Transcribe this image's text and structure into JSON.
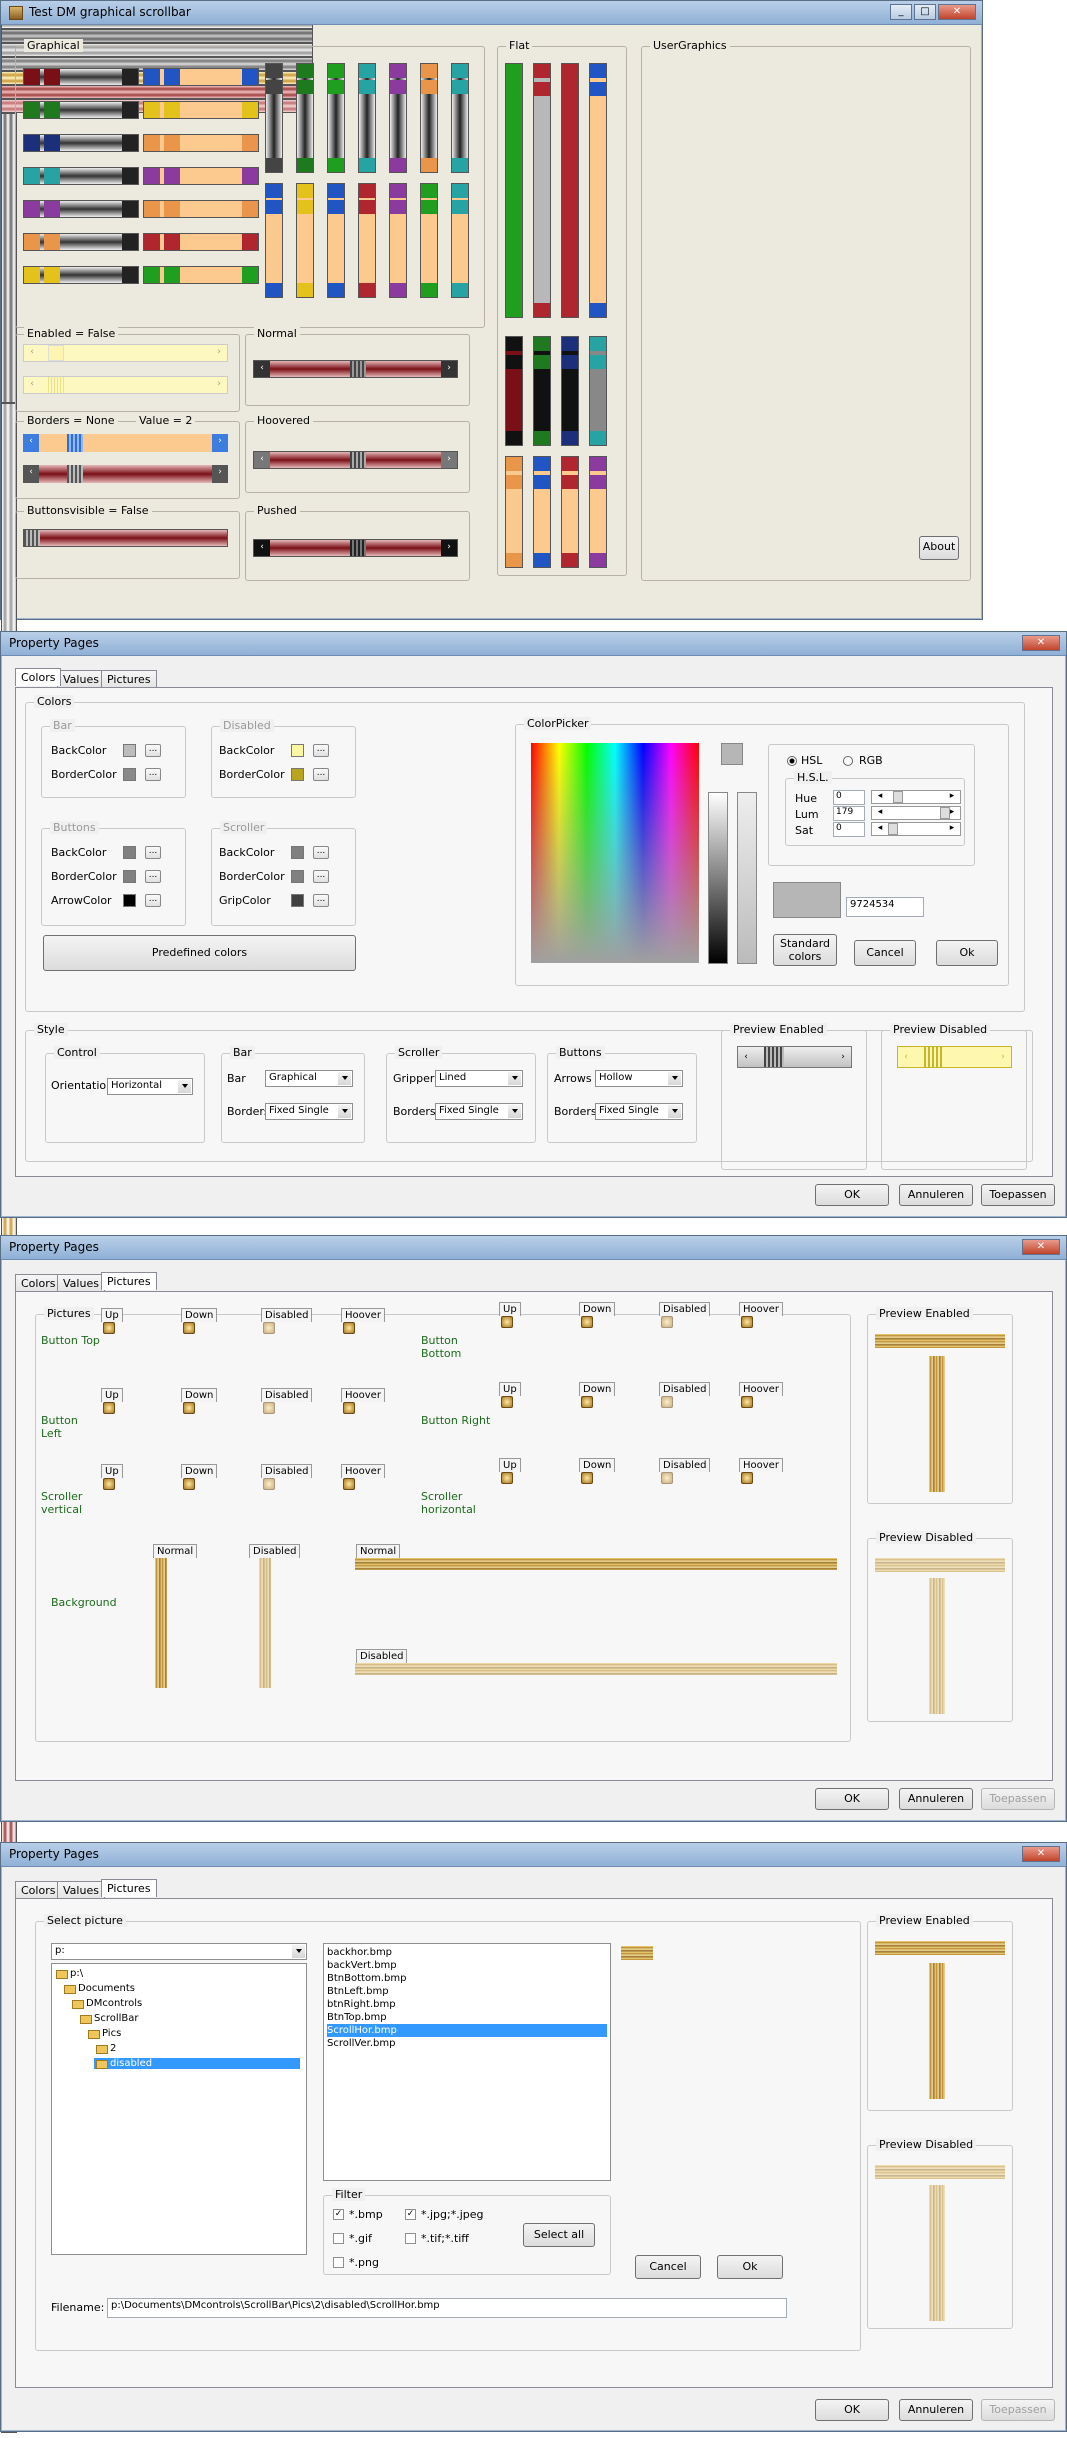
{
  "main": {
    "title": "Test DM graphical scrollbar",
    "groups": {
      "graphical": "Graphical",
      "flat": "Flat",
      "usergraphics": "UserGraphics",
      "enabled": "Enabled = False",
      "normal": "Normal",
      "borders": "Borders = None",
      "value": "Value = 2",
      "hoovered": "Hoovered",
      "buttons": "Buttonsvisible = False",
      "pushed": "Pushed"
    },
    "about": "About",
    "arrows": {
      "left": "‹",
      "right": "›",
      "up": "˄",
      "down": "˅"
    }
  },
  "win2": {
    "title": "Property Pages",
    "tabs": [
      "Colors",
      "Values",
      "Pictures"
    ],
    "colors": {
      "legend": "Colors",
      "bar": {
        "legend": "Bar",
        "rows": [
          "BackColor",
          "BorderColor"
        ]
      },
      "disabled": {
        "legend": "Disabled",
        "rows": [
          "BackColor",
          "BorderColor"
        ]
      },
      "buttons": {
        "legend": "Buttons",
        "rows": [
          "BackColor",
          "BorderColor",
          "ArrowColor"
        ]
      },
      "scroller": {
        "legend": "Scroller",
        "rows": [
          "BackColor",
          "BorderColor",
          "GripColor"
        ]
      },
      "dots": "...",
      "predefined": "Predefined colors"
    },
    "picker": {
      "legend": "ColorPicker",
      "hsl": "HSL",
      "rgb": "RGB",
      "hslgroup": "H.S.L.",
      "hue": "Hue",
      "lum": "Lum",
      "sat": "Sat",
      "hue_val": "0",
      "lum_val": "179",
      "sat_val": "0",
      "color_val": "9724534",
      "standard": "Standard colors",
      "cancel": "Cancel",
      "ok": "Ok"
    },
    "style": {
      "legend": "Style",
      "control": "Control",
      "orientation": "Orientation",
      "orientation_val": "Horizontal",
      "bar": "Bar",
      "bar_lbl": "Bar",
      "bar_val": "Graphical",
      "borders": "Borders",
      "bar_borders_val": "Fixed Single",
      "scroller": "Scroller",
      "gripper": "Gripper",
      "gripper_val": "Lined",
      "scroller_borders_val": "Fixed Single",
      "buttons": "Buttons",
      "arrows": "Arrows",
      "arrows_val": "Hollow",
      "buttons_borders_val": "Fixed Single",
      "preview_enabled": "Preview Enabled",
      "preview_disabled": "Preview Disabled"
    },
    "ok": "OK",
    "cancel": "Annuleren",
    "apply": "Toepassen"
  },
  "win3": {
    "title": "Property Pages",
    "tabs": [
      "Colors",
      "Values",
      "Pictures"
    ],
    "pictures": "Pictures",
    "cols": [
      "Up",
      "Down",
      "Disabled",
      "Hoover"
    ],
    "rows_left": [
      "Button Top",
      "Button Left",
      "Scroller vertical"
    ],
    "rows_right": [
      "Button Bottom",
      "Button Right",
      "Scroller horizontal"
    ],
    "background": "Background",
    "normal": "Normal",
    "disabled": "Disabled",
    "preview_enabled": "Preview Enabled",
    "preview_disabled": "Preview Disabled",
    "ok": "OK",
    "cancel": "Annuleren",
    "apply": "Toepassen"
  },
  "win4": {
    "title": "Property Pages",
    "tabs": [
      "Colors",
      "Values",
      "Pictures"
    ],
    "select": "Select picture",
    "drive": "p:",
    "tree": [
      "p:\\",
      "Documents",
      "DMcontrols",
      "ScrollBar",
      "Pics",
      "2",
      "disabled"
    ],
    "files": [
      "backhor.bmp",
      "backVert.bmp",
      "BtnBottom.bmp",
      "BtnLeft.bmp",
      "btnRight.bmp",
      "BtnTop.bmp",
      "ScrollHor.bmp",
      "ScrollVer.bmp"
    ],
    "selected_file": "ScrollHor.bmp",
    "filter": "Filter",
    "f_bmp": "*.bmp",
    "f_jpg": "*.jpg;*.jpeg",
    "f_gif": "*.gif",
    "f_tif": "*.tif;*.tiff",
    "f_png": "*.png",
    "select_all": "Select all",
    "cancel": "Cancel",
    "okbtn": "Ok",
    "filename_lbl": "Filename:",
    "filename": "p:\\Documents\\DMcontrols\\ScrollBar\\Pics\\2\\disabled\\ScrollHor.bmp",
    "preview_enabled": "Preview Enabled",
    "preview_disabled": "Preview Disabled",
    "ok": "OK",
    "cancel2": "Annuleren",
    "apply": "Toepassen"
  },
  "colors": {
    "red": "#b0262e",
    "green": "#1f9e1f",
    "blue": "#2255c4",
    "yellow": "#e3c21b",
    "purple": "#8b3a9e",
    "orange": "#e9954a",
    "teal": "#27a3a3",
    "gold": "#c99a3a"
  }
}
